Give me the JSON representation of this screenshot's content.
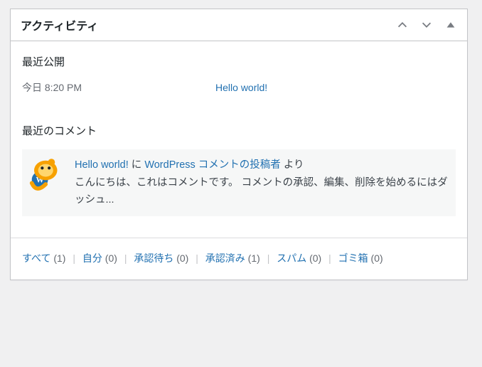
{
  "panel": {
    "title": "アクティビティ"
  },
  "recently_published": {
    "heading": "最近公開",
    "items": [
      {
        "date": "今日 8:20 PM",
        "title": "Hello world!"
      }
    ]
  },
  "recent_comments": {
    "heading": "最近のコメント",
    "items": [
      {
        "post_title": "Hello world!",
        "particle": "に",
        "author": "WordPress コメントの投稿者",
        "from_label": "より",
        "excerpt": "こんにちは、これはコメントです。 コメントの承認、編集、削除を始めるにはダッシュ..."
      }
    ]
  },
  "filters": {
    "all": {
      "label": "すべて",
      "count": "(1)"
    },
    "mine": {
      "label": "自分",
      "count": "(0)"
    },
    "pending": {
      "label": "承認待ち",
      "count": "(0)"
    },
    "approved": {
      "label": "承認済み",
      "count": "(1)"
    },
    "spam": {
      "label": "スパム",
      "count": "(0)"
    },
    "trash": {
      "label": "ゴミ箱",
      "count": "(0)"
    }
  },
  "sep": "|"
}
